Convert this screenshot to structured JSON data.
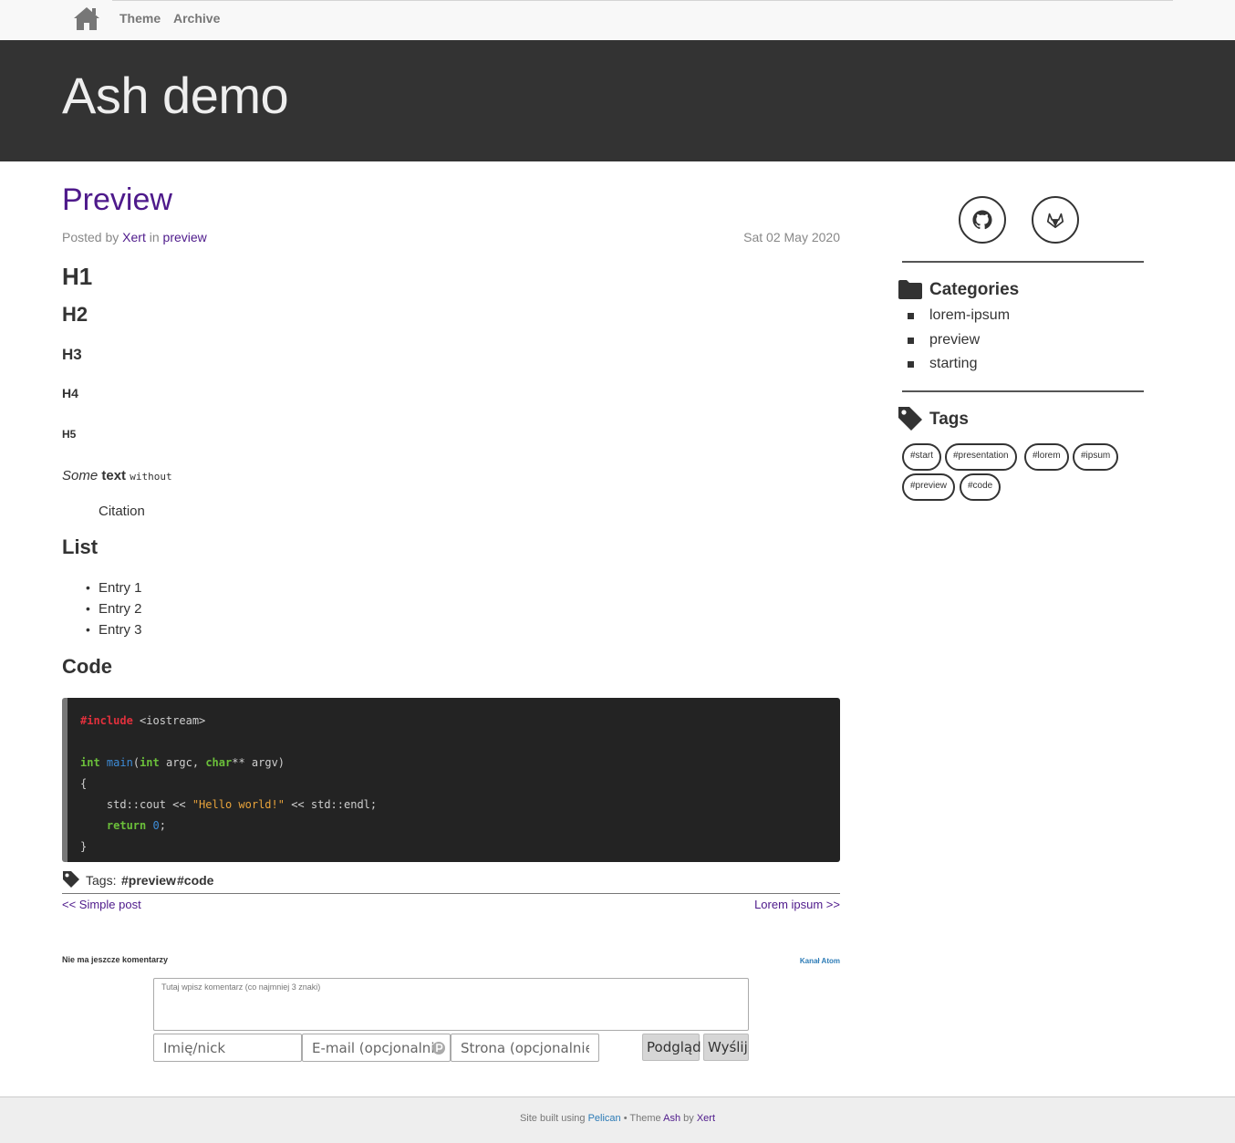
{
  "nav": {
    "theme": "Theme",
    "archive": "Archive"
  },
  "site": {
    "title": "Ash demo"
  },
  "post": {
    "title": "Preview",
    "posted_by": "Posted by",
    "author": "Xert",
    "in": "in",
    "category": "preview",
    "date": "Sat 02 May 2020",
    "h1": "H1",
    "h2": "H2",
    "h3": "H3",
    "h4": "H4",
    "h5": "H5",
    "some": "Some",
    "text": "text",
    "without": "without",
    "citation": "Citation",
    "list_heading": "List",
    "entries": [
      "Entry 1",
      "Entry 2",
      "Entry 3"
    ],
    "code_heading": "Code",
    "code": {
      "include": "#include",
      "header": " <iostream>",
      "int1": "int",
      "main": "main",
      "int2": "int",
      "argc": " argc, ",
      "char": "char",
      "argv": "** argv)",
      "open": "{",
      "cout": "    std::cout << ",
      "str": "\"Hello world!\"",
      "endl": " << std::endl;",
      "return": "return",
      "zero": "0",
      "semi": ";",
      "close": "}"
    },
    "tags_label": "Tags:",
    "tags": [
      "#preview",
      "#code"
    ],
    "prev": "<< Simple post",
    "next": "Lorem ipsum >>"
  },
  "comments": {
    "none": "Nie ma jeszcze komentarzy",
    "atom": "Kanał Atom",
    "placeholder": "Tutaj wpisz komentarz (co najmniej 3 znaki)",
    "name_placeholder": "Imię/nick",
    "email_placeholder": "E-mail (opcjonalnie)",
    "site_placeholder": "Strona (opcjonalnie)",
    "preview_button": "Podgląd",
    "send_button": "Wyślij"
  },
  "sidebar": {
    "categories_heading": "Categories",
    "categories": [
      "lorem-ipsum",
      "preview",
      "starting"
    ],
    "tags_heading": "Tags",
    "tags": [
      "#start",
      "#presentation",
      "#lorem",
      "#ipsum",
      "#preview",
      "#code"
    ]
  },
  "footer": {
    "built": "Site built using",
    "pelican": "Pelican",
    "sep": " • ",
    "theme": "Theme",
    "ash": "Ash",
    "by": "by",
    "xert": "Xert"
  },
  "colors": {
    "link": "#4e1a8b",
    "header_bg": "#333333",
    "footer_link": "#2c7bb6"
  },
  "icons": [
    "home-icon",
    "tag-icon",
    "github-icon",
    "gitlab-icon",
    "folder-icon",
    "tags-icon",
    "p-icon"
  ]
}
